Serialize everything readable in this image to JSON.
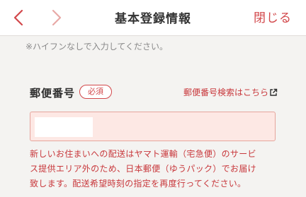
{
  "header": {
    "title": "基本登録情報",
    "close_label": "閉じる",
    "back_icon": "chevron-left-icon",
    "forward_icon": "chevron-right-icon"
  },
  "form": {
    "hint": "※ハイフンなしで入力してください。",
    "postal": {
      "label": "郵便番号",
      "required_badge": "必須",
      "search_link": "郵便番号検索はこちら",
      "search_link_icon": "external-link-icon",
      "value": "",
      "error_line1": "新しいお住まいへの配送はヤマト運輸（宅急便）のサービ",
      "error_line2": "ス提供エリア外のため、日本郵便（ゆうパック）でお届け",
      "error_line3": "致します。配送希望時刻の指定を再度行ってください。"
    }
  },
  "colors": {
    "accent": "#d2474a",
    "error_text": "#c8383c",
    "input_error_bg": "#fde8e4",
    "input_error_border": "#e6a59c",
    "page_bg": "#f4f3f1"
  }
}
